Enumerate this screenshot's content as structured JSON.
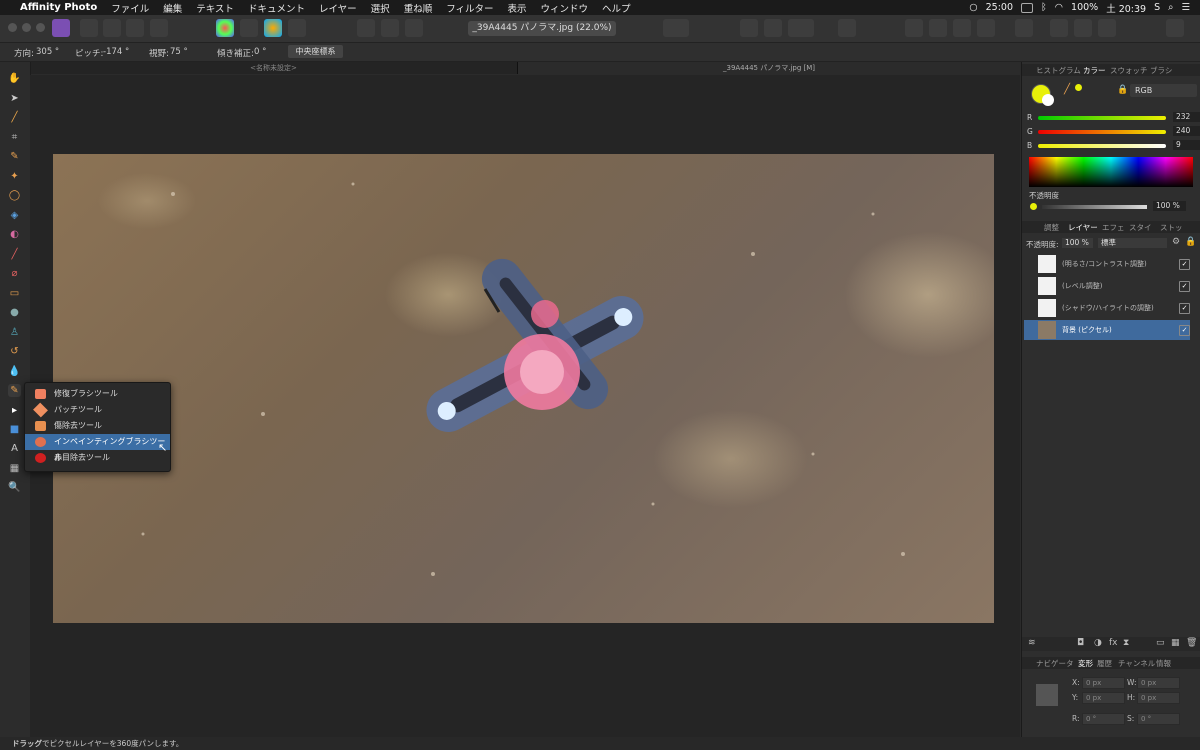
{
  "menubar": {
    "app_name": "Affinity Photo",
    "items": [
      "ファイル",
      "編集",
      "テキスト",
      "ドキュメント",
      "レイヤー",
      "選択",
      "重ね順",
      "フィルター",
      "表示",
      "ウィンドウ",
      "ヘルプ"
    ],
    "clock_timer": "25:00",
    "battery": "100%",
    "datetime": "土 20:39",
    "user_initial": "S"
  },
  "toolbar": {
    "document_title": "_39A4445 パノラマ.jpg (22.0%)"
  },
  "context_bar": {
    "direction_label": "方向:",
    "direction_value": "305 °",
    "pitch_label": "ピッチ:",
    "pitch_value": "-174 °",
    "fov_label": "視野:",
    "fov_value": "75 °",
    "tilt_label": "傾き補正:",
    "tilt_value": "0 °",
    "center_button": "中央座標系"
  },
  "tabs": {
    "tab1": "<名称未設定>",
    "tab2": "_39A4445 パノラマ.jpg [M]"
  },
  "flyout": {
    "items": [
      {
        "label": "修復ブラシツール",
        "selected": false
      },
      {
        "label": "パッチツール",
        "selected": false
      },
      {
        "label": "傷除去ツール",
        "selected": false
      },
      {
        "label": "インペインティングブラシツール",
        "selected": true
      },
      {
        "label": "赤目除去ツール",
        "selected": false
      }
    ]
  },
  "color_panel": {
    "tabs": [
      "ヒストグラム",
      "カラー",
      "スウォッチ",
      "ブラシ"
    ],
    "active_tab": "カラー",
    "mode": "RGB",
    "r_label": "R",
    "r": "232",
    "g_label": "G",
    "g": "240",
    "b_label": "B",
    "b": "9",
    "opacity_label": "不透明度",
    "opacity": "100 %",
    "swatch_color": "#e8f009"
  },
  "layers_panel": {
    "tabs": [
      "調整",
      "レイヤー",
      "エフェ",
      "スタイ",
      "ストッ"
    ],
    "active_tab": "レイヤー",
    "opacity_label": "不透明度:",
    "opacity": "100 %",
    "blend": "標準",
    "layers": [
      {
        "name": "(明るさ/コントラスト調整)",
        "selected": false
      },
      {
        "name": "(レベル調整)",
        "selected": false
      },
      {
        "name": "(シャドウ/ハイライトの調整)",
        "selected": false
      },
      {
        "name": "背景 (ピクセル)",
        "selected": true
      }
    ]
  },
  "transform_panel": {
    "tabs": [
      "ナビゲータ",
      "変形",
      "履歴",
      "チャンネル",
      "情報"
    ],
    "active_tab": "変形",
    "x_label": "X:",
    "x": "0 px",
    "y_label": "Y:",
    "y": "0 px",
    "w_label": "W:",
    "w": "0 px",
    "h_label": "H:",
    "h": "0 px",
    "r_label": "R:",
    "r": "0 °",
    "s_label": "S:",
    "s": "0 °"
  },
  "status": {
    "bold": "ドラッグ",
    "text": "でピクセルレイヤーを360度パンします。"
  }
}
